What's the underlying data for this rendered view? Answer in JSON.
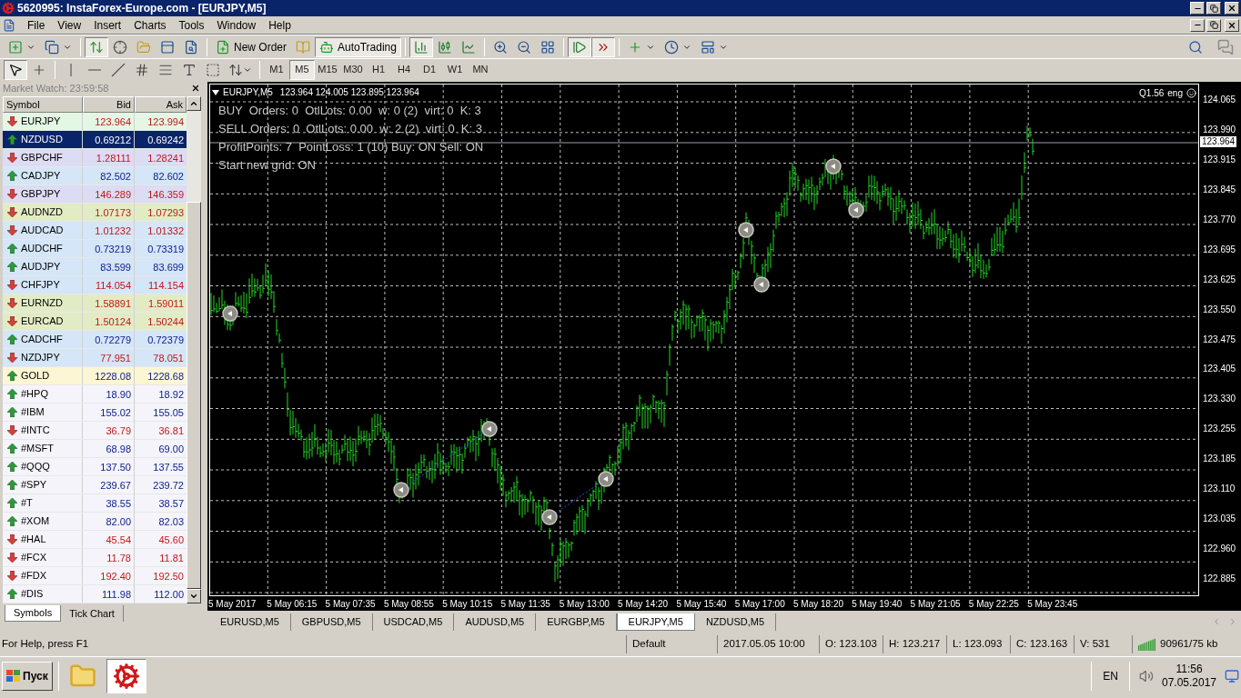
{
  "window": {
    "title": "5620995: InstaForex-Europe.com - [EURJPY,M5]"
  },
  "menu": [
    "File",
    "View",
    "Insert",
    "Charts",
    "Tools",
    "Window",
    "Help"
  ],
  "toolbar_groups": [
    {
      "buttons": [
        {
          "kind": "new-chart"
        },
        {
          "kind": "profiles"
        }
      ]
    },
    {
      "buttons": [
        {
          "kind": "market-watch",
          "on": true
        },
        {
          "kind": "data-window",
          "on": false
        },
        {
          "kind": "navigator",
          "on": false
        },
        {
          "kind": "terminal",
          "on": false
        },
        {
          "kind": "tester",
          "on": false
        }
      ]
    },
    {
      "buttons": [
        {
          "kind": "new-order",
          "label": "New Order"
        },
        {
          "kind": "editor"
        },
        {
          "kind": "autotrading",
          "label": "AutoTrading",
          "on": true
        }
      ]
    },
    {
      "buttons": [
        {
          "kind": "bar-chart",
          "on": true
        },
        {
          "kind": "candles"
        },
        {
          "kind": "line-chart"
        }
      ]
    },
    {
      "buttons": [
        {
          "kind": "zoom-in"
        },
        {
          "kind": "zoom-out"
        },
        {
          "kind": "tile"
        }
      ]
    },
    {
      "buttons": [
        {
          "kind": "auto-scroll",
          "on": true
        },
        {
          "kind": "chart-shift",
          "on": true
        }
      ]
    },
    {
      "buttons": [
        {
          "kind": "indicators"
        },
        {
          "kind": "periods"
        },
        {
          "kind": "templates"
        }
      ]
    }
  ],
  "drawing_tool_groups": [
    {
      "tools": [
        {
          "kind": "cursor",
          "selected": true
        },
        {
          "kind": "crosshair",
          "selected": false
        }
      ]
    },
    {
      "tools": [
        {
          "kind": "vline",
          "selected": false
        },
        {
          "kind": "hline",
          "selected": false
        },
        {
          "kind": "trendline",
          "selected": false
        },
        {
          "kind": "channel",
          "selected": false
        },
        {
          "kind": "fibo",
          "selected": false
        },
        {
          "kind": "text",
          "selected": false
        },
        {
          "kind": "label",
          "selected": false
        },
        {
          "kind": "arrows",
          "selected": false
        }
      ]
    }
  ],
  "timeframes": [
    {
      "label": "M1",
      "selected": false
    },
    {
      "label": "M5",
      "selected": true
    },
    {
      "label": "M15",
      "selected": false
    },
    {
      "label": "M30",
      "selected": false
    },
    {
      "label": "H1",
      "selected": false
    },
    {
      "label": "H4",
      "selected": false
    },
    {
      "label": "D1",
      "selected": false
    },
    {
      "label": "W1",
      "selected": false
    },
    {
      "label": "MN",
      "selected": false
    }
  ],
  "market_watch": {
    "title": "Market Watch: 23:59:58",
    "columns": [
      "Symbol",
      "Bid",
      "Ask"
    ],
    "rows": [
      {
        "symbol": "EURJPY",
        "bid": "123.964",
        "ask": "123.994",
        "rising": false,
        "color": "#e4f6e4",
        "selected": false
      },
      {
        "symbol": "NZDUSD",
        "bid": "0.69212",
        "ask": "0.69242",
        "rising": true,
        "selected": true
      },
      {
        "symbol": "GBPCHF",
        "bid": "1.28111",
        "ask": "1.28241",
        "rising": false,
        "color": "#dcdcf4",
        "selected": false
      },
      {
        "symbol": "CADJPY",
        "bid": "82.502",
        "ask": "82.602",
        "rising": true,
        "color": "#d4e6f8",
        "selected": false
      },
      {
        "symbol": "GBPJPY",
        "bid": "146.289",
        "ask": "146.359",
        "rising": false,
        "color": "#dcdcf4",
        "selected": false
      },
      {
        "symbol": "AUDNZD",
        "bid": "1.07173",
        "ask": "1.07293",
        "rising": false,
        "color": "#e2ecc4",
        "selected": false
      },
      {
        "symbol": "AUDCAD",
        "bid": "1.01232",
        "ask": "1.01332",
        "rising": false,
        "color": "#d4e6f8",
        "selected": false
      },
      {
        "symbol": "AUDCHF",
        "bid": "0.73219",
        "ask": "0.73319",
        "rising": true,
        "color": "#d4e6f8",
        "selected": false
      },
      {
        "symbol": "AUDJPY",
        "bid": "83.599",
        "ask": "83.699",
        "rising": true,
        "color": "#d4e6f8",
        "selected": false
      },
      {
        "symbol": "CHFJPY",
        "bid": "114.054",
        "ask": "114.154",
        "rising": false,
        "color": "#d4e6f8",
        "selected": false
      },
      {
        "symbol": "EURNZD",
        "bid": "1.58891",
        "ask": "1.59011",
        "rising": false,
        "color": "#e2ecc4",
        "selected": false
      },
      {
        "symbol": "EURCAD",
        "bid": "1.50124",
        "ask": "1.50244",
        "rising": false,
        "color": "#e2ecc4",
        "selected": false
      },
      {
        "symbol": "CADCHF",
        "bid": "0.72279",
        "ask": "0.72379",
        "rising": true,
        "color": "#d4e6f8",
        "selected": false
      },
      {
        "symbol": "NZDJPY",
        "bid": "77.951",
        "ask": "78.051",
        "rising": false,
        "color": "#d4e6f8",
        "selected": false
      },
      {
        "symbol": "GOLD",
        "bid": "1228.08",
        "ask": "1228.68",
        "rising": true,
        "color": "#fcf6d4",
        "selected": false
      },
      {
        "symbol": "#HPQ",
        "bid": "18.90",
        "ask": "18.92",
        "rising": true,
        "color": "#f4f4fa",
        "selected": false
      },
      {
        "symbol": "#IBM",
        "bid": "155.02",
        "ask": "155.05",
        "rising": true,
        "color": "#f4f4fa",
        "selected": false
      },
      {
        "symbol": "#INTC",
        "bid": "36.79",
        "ask": "36.81",
        "rising": false,
        "color": "#f4f4fa",
        "selected": false
      },
      {
        "symbol": "#MSFT",
        "bid": "68.98",
        "ask": "69.00",
        "rising": true,
        "color": "#f4f4fa",
        "selected": false
      },
      {
        "symbol": "#QQQ",
        "bid": "137.50",
        "ask": "137.55",
        "rising": true,
        "color": "#f4f4fa",
        "selected": false
      },
      {
        "symbol": "#SPY",
        "bid": "239.67",
        "ask": "239.72",
        "rising": true,
        "color": "#f4f4fa",
        "selected": false
      },
      {
        "symbol": "#T",
        "bid": "38.55",
        "ask": "38.57",
        "rising": true,
        "color": "#f4f4fa",
        "selected": false
      },
      {
        "symbol": "#XOM",
        "bid": "82.00",
        "ask": "82.03",
        "rising": true,
        "color": "#f4f4fa",
        "selected": false
      },
      {
        "symbol": "#HAL",
        "bid": "45.54",
        "ask": "45.60",
        "rising": false,
        "color": "#f4f4fa",
        "selected": false
      },
      {
        "symbol": "#FCX",
        "bid": "11.78",
        "ask": "11.81",
        "rising": false,
        "color": "#f4f4fa",
        "selected": false
      },
      {
        "symbol": "#FDX",
        "bid": "192.40",
        "ask": "192.50",
        "rising": false,
        "color": "#f4f4fa",
        "selected": false
      },
      {
        "symbol": "#DIS",
        "bid": "111.98",
        "ask": "112.00",
        "rising": true,
        "color": "#f4f4fa",
        "selected": false
      }
    ],
    "tabs": [
      {
        "label": "Symbols",
        "selected": true
      },
      {
        "label": "Tick Chart",
        "selected": false
      }
    ]
  },
  "chart": {
    "symbol": "EURJPY,M5",
    "ohlc": "123.964 124.005 123.895 123.964",
    "info_lines": [
      "BUY  Orders: 0  OtlLots: 0.00  w: 0 (2)  virt: 0  K: 3",
      "SELL Orders: 0  OtlLots: 0.00  w: 2 (2)  virt: 0  K: 3",
      "ProfitPoints: 7  PointLoss: 1 (10) Buy: ON Sell: ON",
      "Start new grid: ON"
    ],
    "corner_label": "Q1.56",
    "corner_lang": "eng",
    "current_price": "123.964",
    "price_labels": [
      "124.065",
      "123.990",
      "123.915",
      "123.845",
      "123.770",
      "123.695",
      "123.625",
      "123.550",
      "123.475",
      "123.405",
      "123.330",
      "123.255",
      "123.185",
      "123.110",
      "123.035",
      "122.960",
      "122.885"
    ],
    "time_labels": [
      "5 May 2017",
      "5 May 06:15",
      "5 May 07:35",
      "5 May 08:55",
      "5 May 10:15",
      "5 May 11:35",
      "5 May 13:00",
      "5 May 14:20",
      "5 May 15:40",
      "5 May 17:00",
      "5 May 18:20",
      "5 May 19:40",
      "5 May 21:05",
      "5 May 22:25",
      "5 May 23:45"
    ]
  },
  "chart_tabs": [
    {
      "label": "EURUSD,M5",
      "selected": false
    },
    {
      "label": "GBPUSD,M5",
      "selected": false
    },
    {
      "label": "USDCAD,M5",
      "selected": false
    },
    {
      "label": "AUDUSD,M5",
      "selected": false
    },
    {
      "label": "EURGBP,M5",
      "selected": false
    },
    {
      "label": "EURJPY,M5",
      "selected": true
    },
    {
      "label": "NZDUSD,M5",
      "selected": false
    }
  ],
  "status_bar": {
    "help": "For Help, press F1",
    "profile": "Default",
    "datetime": "2017.05.05 10:00",
    "open": "O: 123.103",
    "high": "H: 123.217",
    "low": "L: 123.093",
    "close": "C: 123.163",
    "volume": "V: 531",
    "traffic": "90961/75 kb"
  },
  "taskbar": {
    "start": "Пуск",
    "language": "EN",
    "time": "11:56",
    "date": "07.05.2017"
  }
}
